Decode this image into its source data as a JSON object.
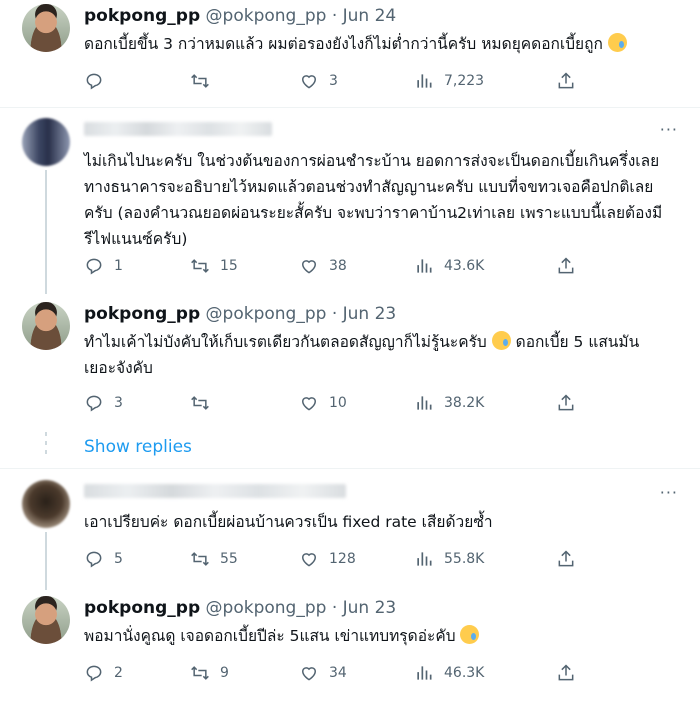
{
  "tweets": [
    {
      "name": "pokpong_pp",
      "handle": "@pokpong_pp",
      "date": "Jun 24",
      "text": "ดอกเบี้ยขึ้น 3 กว่าหมดแล้ว ผมต่อรองยังไงก็ไม่ต่ำกว่านี้ครับ หมดยุคดอกเบี้ยถูก",
      "emoji": "crying-face-emoji",
      "replies": "",
      "retweets": "",
      "likes": "3",
      "views": "7,223"
    },
    {
      "name": "",
      "handle": "",
      "date": "",
      "text": "ไม่เกินไปนะครับ ในช่วงต้นของการผ่อนชำระบ้าน ยอดการส่งจะเป็นดอกเบี้ยเกินครึ่งเลย ทางธนาคารจะอธิบายไว้หมดแล้วตอนช่วงทำสัญญานะครับ แบบที่จขทวเจอคือปกติเลยครับ (ลองคำนวณยอดผ่อนระยะสั้ครับ จะพบว่าราคาบ้าน2เท่าเลย เพราะแบบนี้เลยต้องมีรีไฟแนนซ์ครับ)",
      "replies": "1",
      "retweets": "15",
      "likes": "38",
      "views": "43.6K"
    },
    {
      "name": "pokpong_pp",
      "handle": "@pokpong_pp",
      "date": "Jun 23",
      "text": "ทำไมเค้าไม่บังคับให้เก็บเรตเดียวกันตลอดสัญญาก็ไม่รู้นะครับ",
      "text2": "ดอกเบี้ย 5 แสนมันเยอะจังคับ",
      "emoji": "loudly-crying-face-emoji",
      "replies": "3",
      "retweets": "",
      "likes": "10",
      "views": "38.2K"
    },
    {
      "name": "",
      "handle": "",
      "date": "",
      "text": "เอาเปรียบค่ะ ดอกเบี้ยผ่อนบ้านควรเป็น fixed rate เสียด้วยซ้ำ",
      "replies": "5",
      "retweets": "55",
      "likes": "128",
      "views": "55.8K"
    },
    {
      "name": "pokpong_pp",
      "handle": "@pokpong_pp",
      "date": "Jun 23",
      "text": "พอมานั่งคูณดู เจอดอกเบี้ยปีล่ะ 5แสน เข่าแทบทรุดอ่ะคับ",
      "emoji": "crying-face-emoji",
      "replies": "2",
      "retweets": "9",
      "likes": "34",
      "views": "46.3K"
    }
  ],
  "show_replies_label": "Show replies",
  "more_label": "···",
  "colors": {
    "link": "#1d9bf0",
    "secondary": "#536471",
    "divider": "#eff3f4"
  }
}
